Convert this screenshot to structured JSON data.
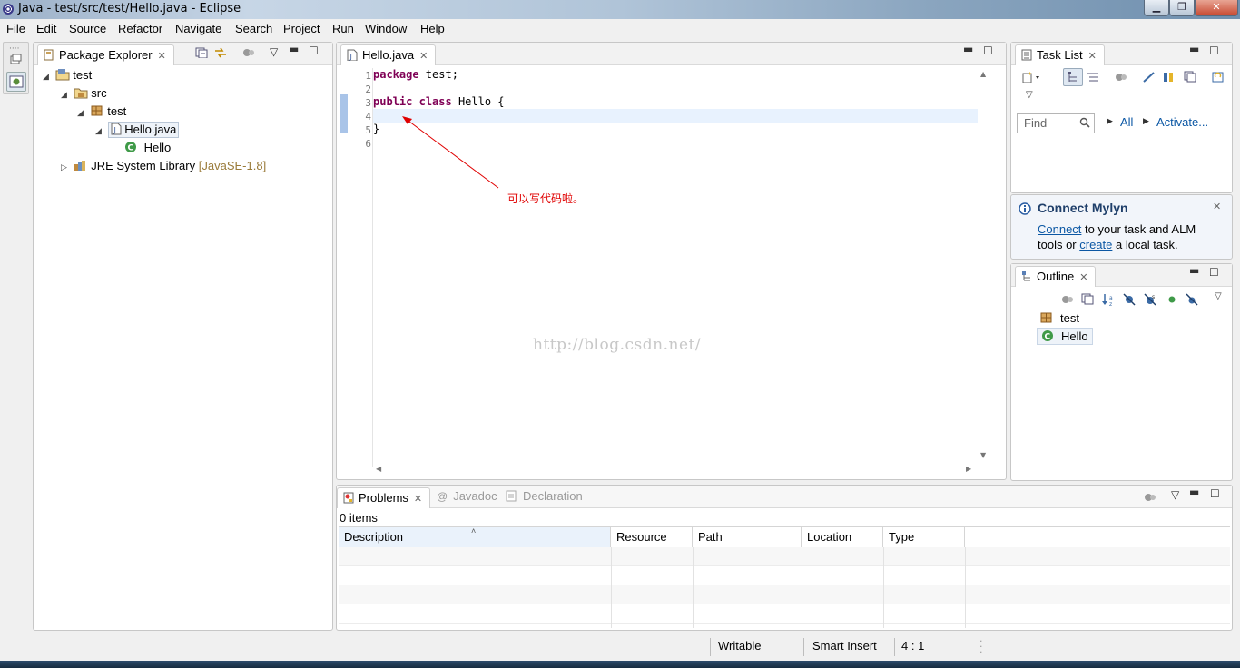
{
  "window": {
    "title": "Java - test/src/test/Hello.java - Eclipse"
  },
  "menubar": [
    "File",
    "Edit",
    "Source",
    "Refactor",
    "Navigate",
    "Search",
    "Project",
    "Run",
    "Window",
    "Help"
  ],
  "package_explorer": {
    "tab_label": "Package Explorer",
    "tree": {
      "project": "test",
      "src": "src",
      "package": "test",
      "file": "Hello.java",
      "class": "Hello",
      "library": "JRE System Library",
      "library_suffix": "[JavaSE-1.8]"
    }
  },
  "editor": {
    "tab_label": "Hello.java",
    "line_numbers": [
      "1",
      "2",
      "3",
      "4",
      "5",
      "6"
    ],
    "lines": {
      "l1_kw": "package",
      "l1_rest": " test;",
      "l3_kw1": "public",
      "l3_kw2": "class",
      "l3_rest": " Hello {",
      "l5": "}"
    },
    "annotation": "可以写代码啦。",
    "watermark": "http://blog.csdn.net/"
  },
  "task_list": {
    "tab_label": "Task List",
    "find_placeholder": "Find",
    "all_label": "All",
    "activate_label": "Activate..."
  },
  "mylyn": {
    "title": "Connect Mylyn",
    "connect_link": "Connect",
    "text1": " to your task and ALM",
    "text2_prefix": "tools or ",
    "create_link": "create",
    "text2_suffix": " a local task."
  },
  "outline": {
    "tab_label": "Outline",
    "items": [
      "test",
      "Hello"
    ]
  },
  "bottom_panel": {
    "tabs": [
      "Problems",
      "Javadoc",
      "Declaration"
    ],
    "count": "0 items",
    "columns": [
      "Description",
      "Resource",
      "Path",
      "Location",
      "Type"
    ]
  },
  "status": {
    "writable": "Writable",
    "insert_mode": "Smart Insert",
    "position": "4 : 1"
  },
  "colors": {
    "keyword": "#7f0055",
    "annotation": "#e00000",
    "link": "#0b57a4",
    "current_line": "#e8f2fe"
  }
}
